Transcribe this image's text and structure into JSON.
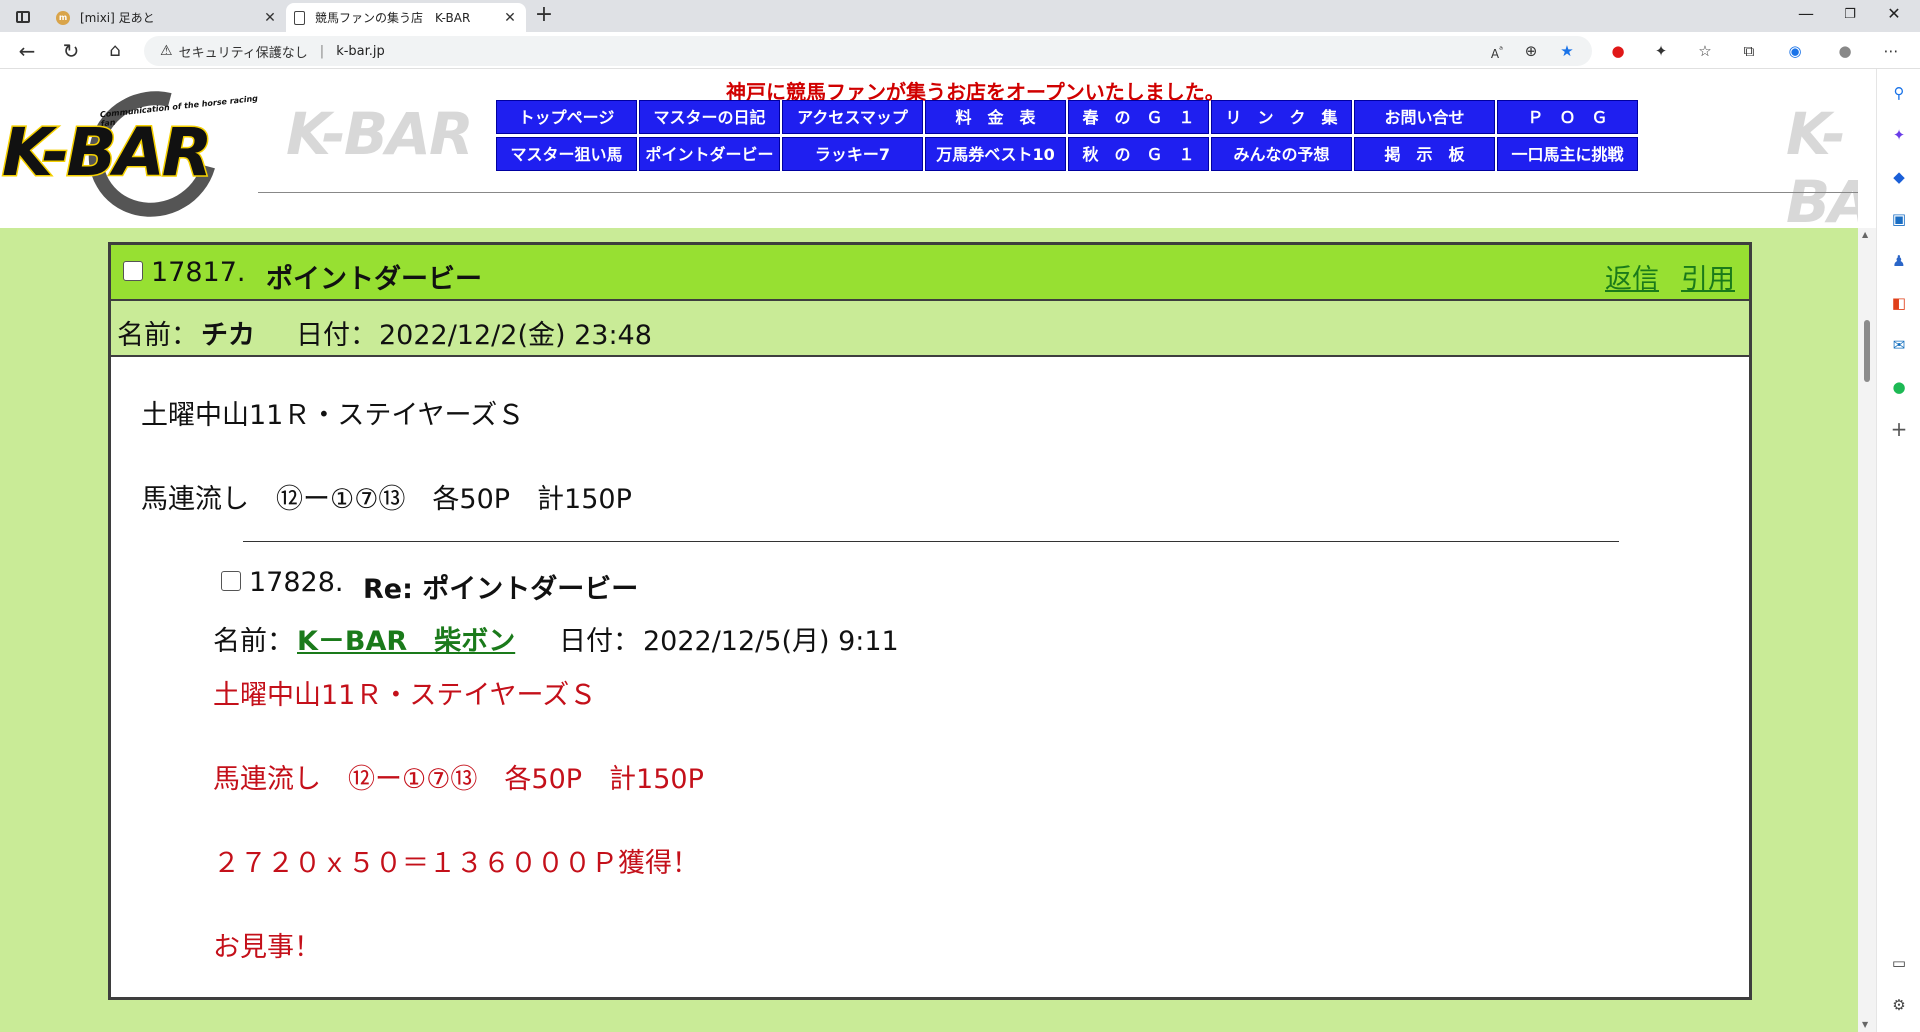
{
  "browser": {
    "tabs": [
      {
        "title": "[mixi] 足あと",
        "favicon": "mixi-icon",
        "active": false
      },
      {
        "title": "競馬ファンの集う店　K-BAR",
        "favicon": "document-icon",
        "active": true
      }
    ],
    "security_label": "セキュリティ保護なし",
    "url": "k-bar.jp"
  },
  "site": {
    "logo_text": "K-BAR",
    "logo_subtitle": "Communication of the horse racing fan",
    "tagline": "神戸に競馬ファンが集うお店をオープンいたしました。",
    "nav": [
      "トップページ",
      "マスターの日記",
      "アクセスマップ",
      "料　金　表",
      "春　の　Ｇ　１",
      "リ　ン　ク　集",
      "お問い合せ",
      "Ｐ　Ｏ　Ｇ",
      "マスター狙い馬",
      "ポイントダービー",
      "ラッキー7",
      "万馬券ベスト10",
      "秋　の　Ｇ　１",
      "みんなの予想",
      "掲　示　板",
      "一口馬主に挑戦"
    ]
  },
  "post": {
    "number": "17817.",
    "title": "ポイントダービー",
    "reply_link": "返信",
    "quote_link": "引用",
    "name_label": "名前：",
    "name": "チカ",
    "date_label": "日付：",
    "date": "2022/12/2(金) 23:48",
    "lines": [
      "土曜中山11Ｒ・ステイヤーズＳ",
      "馬連流し　⑫ー①⑦⑬　各50P　計150P"
    ]
  },
  "reply": {
    "number": "17828.",
    "title": "Re: ポイントダービー",
    "name_label": "名前：",
    "name": "K－BAR　柴ボン",
    "date_label": "日付：",
    "date": "2022/12/5(月) 9:11",
    "lines": [
      "土曜中山11Ｒ・ステイヤーズＳ",
      "馬連流し　⑫ー①⑦⑬　各50P　計150P",
      "２７２０ｘ５０＝１３６０００Ｐ獲得！",
      "お見事！"
    ]
  },
  "colors": {
    "page_bg": "#c9eb97",
    "post_header": "#97e032",
    "nav_button": "#1f1ff0",
    "tagline": "#d00000",
    "reply_text": "#c4101a",
    "link": "#1a7a1a"
  }
}
